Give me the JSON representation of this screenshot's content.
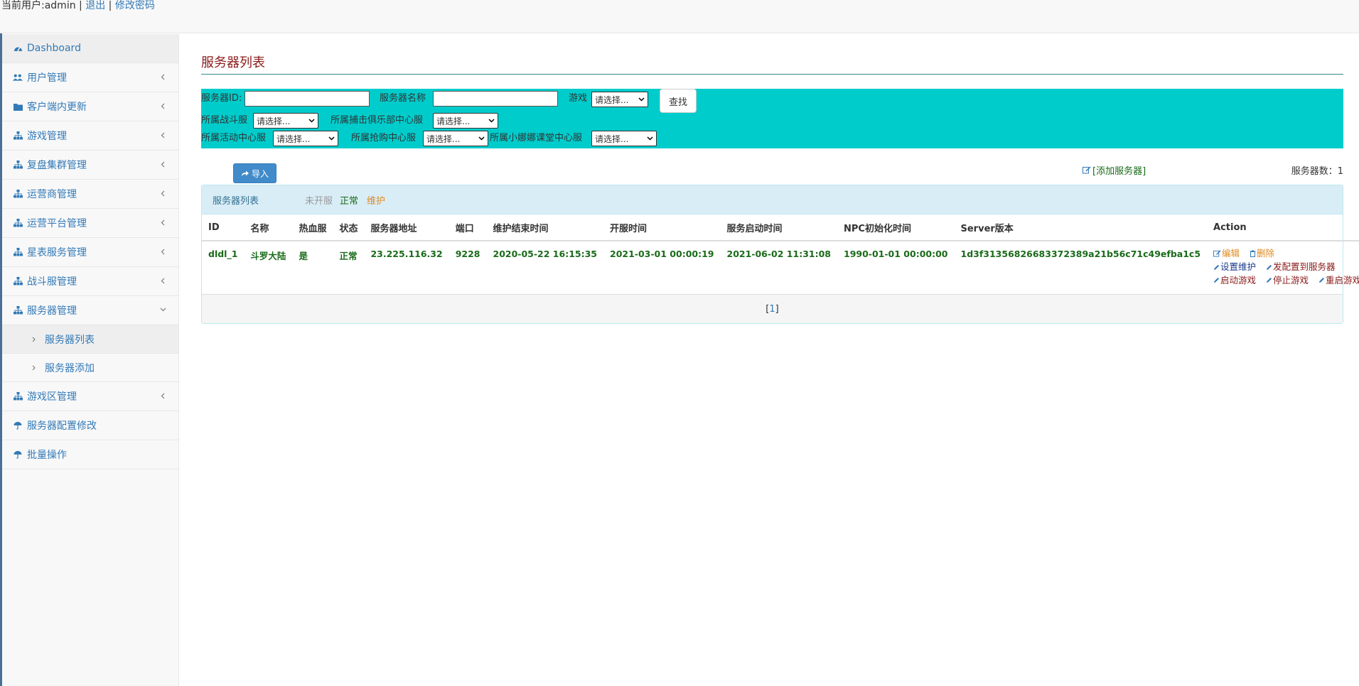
{
  "topbar": {
    "user_text": "当前用户:admin |",
    "logout": "退出",
    "sep": "|",
    "change_password": "修改密码"
  },
  "sidebar": {
    "items": [
      {
        "label": "Dashboard",
        "icon": "dashboard-icon"
      },
      {
        "label": "用户管理",
        "icon": "users-icon"
      },
      {
        "label": "客户端内更新",
        "icon": "folder-icon"
      },
      {
        "label": "游戏管理",
        "icon": "sitemap-icon"
      },
      {
        "label": "复盘集群管理",
        "icon": "sitemap-icon"
      },
      {
        "label": "运营商管理",
        "icon": "sitemap-icon"
      },
      {
        "label": "运营平台管理",
        "icon": "sitemap-icon"
      },
      {
        "label": "星表服务管理",
        "icon": "sitemap-icon"
      },
      {
        "label": "战斗服管理",
        "icon": "sitemap-icon"
      },
      {
        "label": "服务器管理",
        "icon": "sitemap-icon"
      },
      {
        "label": "游戏区管理",
        "icon": "sitemap-icon"
      },
      {
        "label": "服务器配置修改",
        "icon": "umbrella-icon"
      },
      {
        "label": "批量操作",
        "icon": "umbrella-icon"
      }
    ],
    "sub_items": [
      {
        "label": "服务器列表"
      },
      {
        "label": "服务器添加"
      }
    ]
  },
  "main": {
    "title": "服务器列表",
    "filter": {
      "server_id_label": "服务器ID:",
      "server_name_label": "服务器名称",
      "game_label": "游戏",
      "select_placeholder": "请选择...",
      "search_button": "查找",
      "battle_label": "所属战斗服",
      "club_label": "所属捕击俱乐部中心服",
      "activity_label": "所属活动中心服",
      "rush_label": "所属抢购中心服",
      "class_label": "所属小娜娜课堂中心服"
    },
    "toolbar": {
      "import_button": "导入",
      "add_server": "[添加服务器]",
      "count_label": "服务器数：1"
    },
    "panel": {
      "title": "服务器列表",
      "legend_closed": "未开服",
      "legend_normal": "正常",
      "legend_maintain": "维护"
    },
    "colors": {
      "closed": "#999999",
      "normal": "#1a6b1a",
      "maintain": "#e08a1e"
    },
    "table": {
      "headers": [
        "ID",
        "名称",
        "热血服",
        "状态",
        "服务器地址",
        "端口",
        "维护结束时间",
        "开服时间",
        "服务启动时间",
        "NPC初始化时间",
        "Server版本",
        "Action"
      ],
      "rows": [
        {
          "id": "dldl_1",
          "name": "斗罗大陆",
          "hot": "是",
          "status": "正常",
          "address": "23.225.116.32",
          "port": "9228",
          "maintain_end": "2020-05-22 16:15:35",
          "open_time": "2021-03-01 00:00:19",
          "start_time": "2021-06-02 11:31:08",
          "npc_init": "1990-01-01 00:00:00",
          "version": "1d3f31356826683372389a21b56c71c49efba1c5",
          "actions": {
            "edit": "编辑",
            "delete": "删除",
            "set_maintain": "设置维护",
            "send_config": "发配置到服务器",
            "start_game": "启动游戏",
            "stop_game": "停止游戏",
            "restart_game": "重启游戏"
          }
        }
      ]
    },
    "pager": {
      "left": "[",
      "page": "1",
      "right": "]"
    }
  }
}
